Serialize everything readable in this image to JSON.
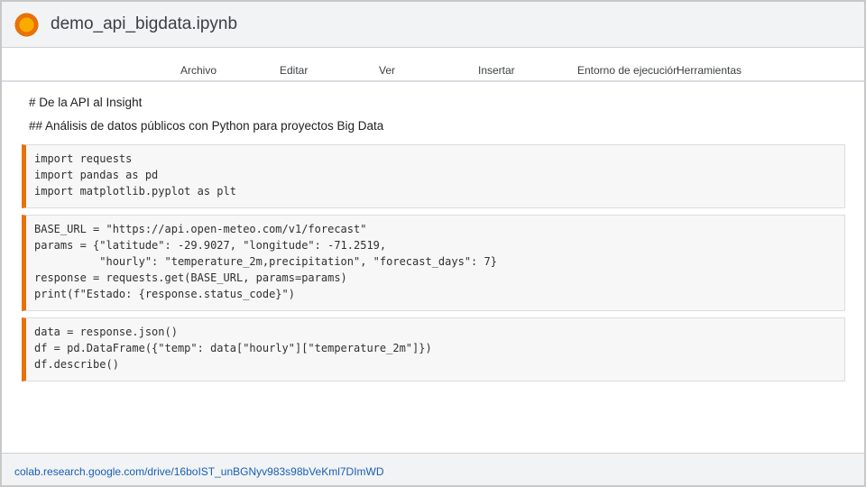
{
  "title": "demo_api_bigdata.ipynb",
  "menu": [
    "Archivo",
    "Editar",
    "Ver",
    "Insertar",
    "Entorno de ejecución",
    "Herramientas"
  ],
  "markdown": [
    "# De la API al Insight",
    "## Análisis de datos públicos con Python para proyectos Big Data"
  ],
  "cells": [
    {
      "lines": [
        "import requests",
        "import pandas as pd",
        "import matplotlib.pyplot as plt"
      ]
    },
    {
      "lines": [
        "BASE_URL = \"https://api.open-meteo.com/v1/forecast\"",
        "params = {\"latitude\": -29.9027, \"longitude\": -71.2519,",
        "          \"hourly\": \"temperature_2m,precipitation\", \"forecast_days\": 7}",
        "response = requests.get(BASE_URL, params=params)",
        "print(f\"Estado: {response.status_code}\")"
      ]
    },
    {
      "lines": [
        "data = response.json()",
        "df = pd.DataFrame({\"temp\": data[\"hourly\"][\"temperature_2m\"]})",
        "df.describe()"
      ]
    }
  ],
  "status_url": "colab.research.google.com/drive/16boIST_unBGNyv983s98bVeKml7DImWD",
  "colors": {
    "accent": "#e8710a",
    "logo_inner": "#f9ab00",
    "link": "#1a5fb4"
  }
}
